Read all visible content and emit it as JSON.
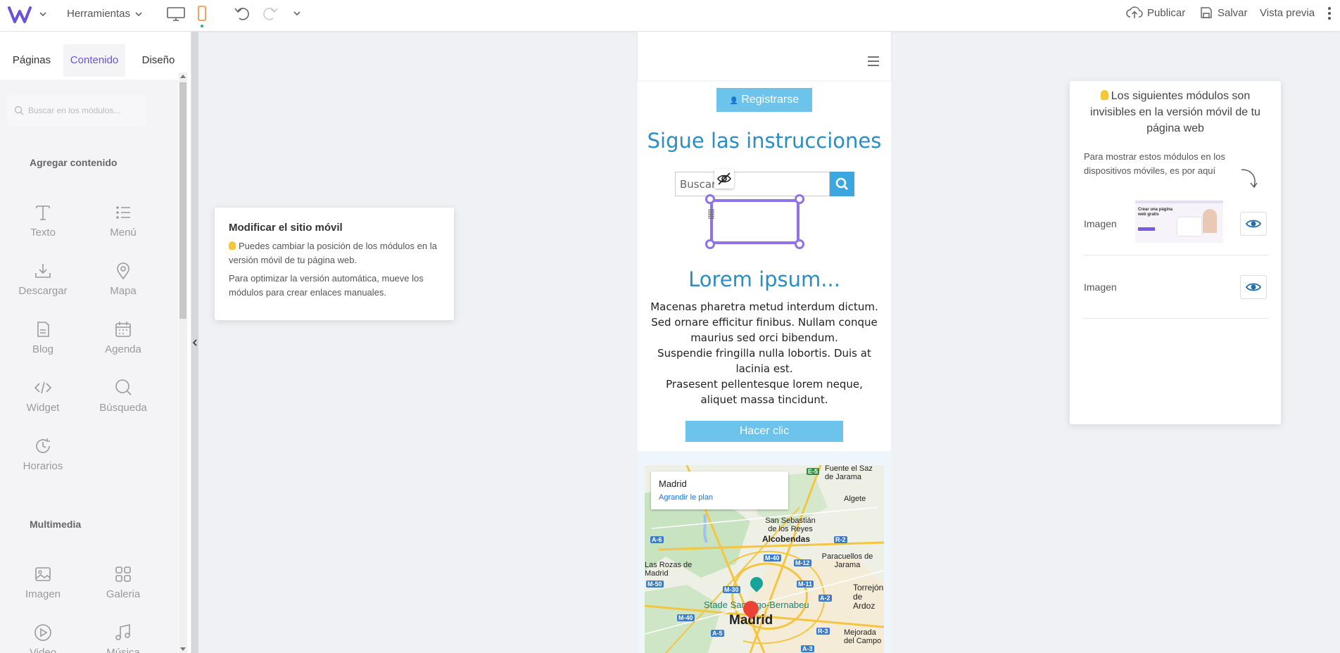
{
  "topbar": {
    "tools_label": "Herramientas",
    "publish_label": "Publicar",
    "save_label": "Salvar",
    "preview_label": "Vista previa"
  },
  "sidebar": {
    "tabs": [
      {
        "label": "Páginas"
      },
      {
        "label": "Contenido",
        "active": true
      },
      {
        "label": "Diseño"
      }
    ],
    "search_placeholder": "Buscar en los módulos...",
    "section_add": "Agregar contenido",
    "modules": [
      {
        "label": "Texto",
        "icon": "text-icon"
      },
      {
        "label": "Menú",
        "icon": "menu-list-icon"
      },
      {
        "label": "Descargar",
        "icon": "download-icon"
      },
      {
        "label": "Mapa",
        "icon": "map-pin-icon"
      },
      {
        "label": "Blog",
        "icon": "blog-icon"
      },
      {
        "label": "Agenda",
        "icon": "calendar-icon"
      },
      {
        "label": "Widget",
        "icon": "code-icon"
      },
      {
        "label": "Búsqueda",
        "icon": "search-icon"
      },
      {
        "label": "Horarios",
        "icon": "clock-icon"
      }
    ],
    "section_media": "Multimedia",
    "media_modules": [
      {
        "label": "Imagen",
        "icon": "image-icon"
      },
      {
        "label": "Galeria",
        "icon": "gallery-icon"
      },
      {
        "label": "Video",
        "icon": "play-icon"
      },
      {
        "label": "Música",
        "icon": "music-icon"
      }
    ]
  },
  "tooltip": {
    "title": "Modificar el sitio móvil",
    "line1": "Puedes cambiar la posición de los módulos en la versión móvil de tu página web.",
    "line2": "Para optimizar la versión automática, mueve los módulos para crear enlaces manuales."
  },
  "phone": {
    "register_label": "Registrarse",
    "heading": "Sigue las instrucciones",
    "search_placeholder": "Buscar...",
    "lorem_heading": "Lorem ipsum...",
    "paragraph1": "Macenas pharetra metud interdum dictum. Sed ornare efficitur finibus. Nullam conque maurius sed orci bibendum.",
    "paragraph2": "Suspendie fringilla nulla lobortis. Duis at lacinia est.",
    "paragraph3": "Prasesent pellentesque lorem neque, aliquet massa tincidunt.",
    "cta_label": "Hacer clic",
    "map": {
      "place_title": "Madrid",
      "enlarge_link": "Agrandir le plan",
      "labels": {
        "fuente": "Fuente el Saz de Jarama",
        "algete": "Algete",
        "sanseb": "San Sebastián de los Reyes",
        "alcobendas": "Alcobendas",
        "lasrozas": "Las Rozas de Madrid",
        "paracuellos": "Paracuellos de Jarama",
        "torrejon": "Torrejón de Ardoz",
        "stade": "Stade Santiago-Bernabeu",
        "madrid": "Madrid",
        "mejorada": "Mejorada del Campo"
      },
      "roads": [
        "E-5",
        "A-6",
        "R-2",
        "M-40",
        "M-12",
        "M-50",
        "M-30",
        "M-11",
        "A-2",
        "M-40",
        "A-5",
        "R-3",
        "A-3"
      ]
    }
  },
  "hidden_panel": {
    "title": "Los siguientes módulos son invisibles en la versión móvil de tu página web",
    "hint": "Para mostrar estos módulos en los dispositivos móviles, es por aquí",
    "items": [
      {
        "label": "Imagen",
        "thumb_text": "Crear una página web gratis"
      },
      {
        "label": "Imagen"
      }
    ]
  },
  "colors": {
    "accent": "#6c52d6",
    "selection": "#8f72e8",
    "blue_button": "#6cc4ec",
    "heading_blue": "#2a8dc3",
    "mobile_icon": "#f08a3c"
  }
}
